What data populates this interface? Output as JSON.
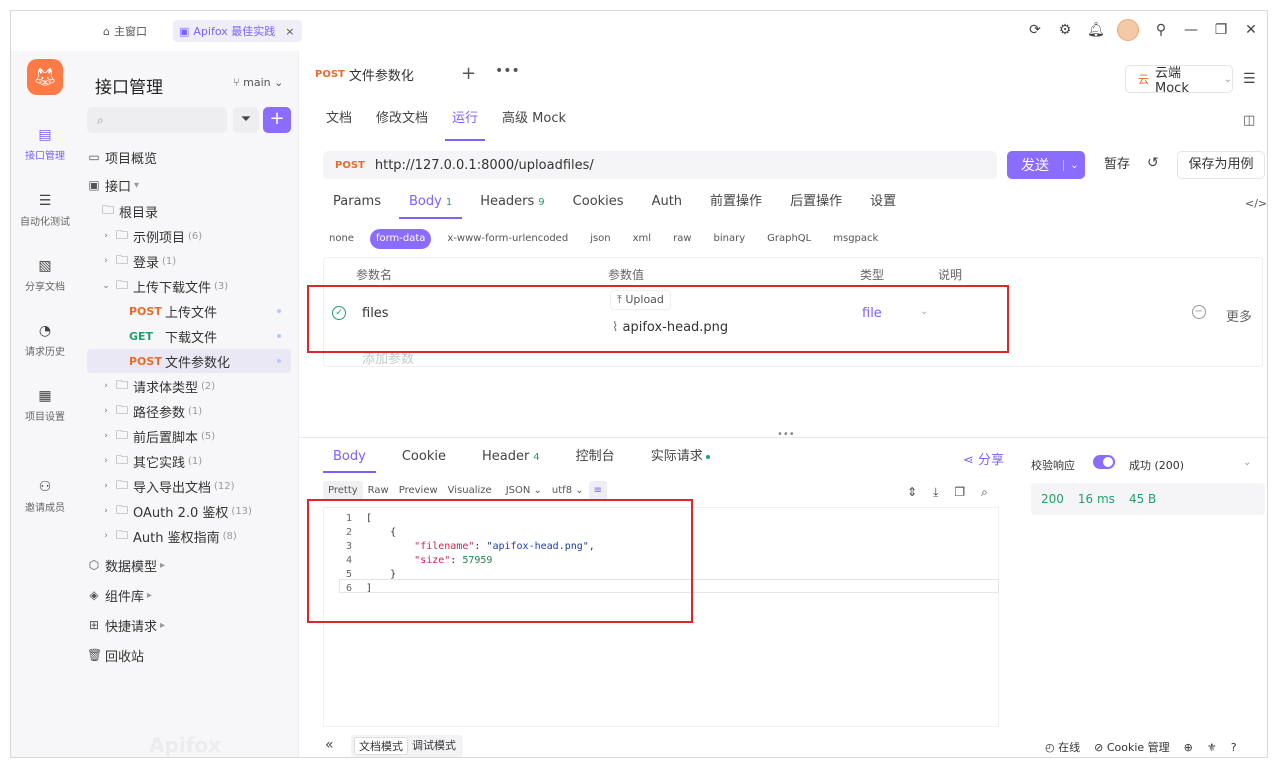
{
  "titlebar": {
    "home_label": "主窗口",
    "project_tab": "Apifox 最佳实践",
    "close_glyph": "×"
  },
  "rail": {
    "items": [
      {
        "label": "接口管理",
        "icon": "api-icon",
        "active": true
      },
      {
        "label": "自动化测试",
        "icon": "test-icon"
      },
      {
        "label": "分享文档",
        "icon": "share-doc-icon"
      },
      {
        "label": "请求历史",
        "icon": "history-icon"
      },
      {
        "label": "项目设置",
        "icon": "settings-icon"
      },
      {
        "label": "邀请成员",
        "icon": "invite-icon"
      }
    ]
  },
  "tree": {
    "title": "接口管理",
    "branch": "main",
    "overview": "项目概览",
    "interface_label": "接口",
    "root": "根目录",
    "folders": [
      {
        "name": "示例项目",
        "count": "(6)"
      },
      {
        "name": "登录",
        "count": "(1)"
      },
      {
        "name": "上传下载文件",
        "count": "(3)"
      }
    ],
    "endpoints": [
      {
        "method": "POST",
        "name": "上传文件"
      },
      {
        "method": "GET",
        "name": "下载文件"
      },
      {
        "method": "POST",
        "name": "文件参数化"
      }
    ],
    "folders2": [
      {
        "name": "请求体类型",
        "count": "(2)"
      },
      {
        "name": "路径参数",
        "count": "(1)"
      },
      {
        "name": "前后置脚本",
        "count": "(5)"
      },
      {
        "name": "其它实践",
        "count": "(1)"
      },
      {
        "name": "导入导出文档",
        "count": "(12)"
      },
      {
        "name": "OAuth 2.0 鉴权",
        "count": "(13)"
      },
      {
        "name": "Auth 鉴权指南",
        "count": "(8)"
      }
    ],
    "bottom": [
      "数据模型",
      "组件库",
      "快捷请求",
      "回收站"
    ],
    "watermark": "Apifox"
  },
  "main": {
    "request_tab": {
      "method": "POST",
      "title": "文件参数化"
    },
    "mock_label": "云端 Mock",
    "mock_tag": "云",
    "subtabs": [
      "文档",
      "修改文档",
      "运行",
      "高级 Mock"
    ],
    "active_subtab": 2,
    "url": {
      "method": "POST",
      "value": "http://127.0.0.1:8000/uploadfiles/"
    },
    "send": "发送",
    "save": "暂存",
    "save_case": "保存为用例",
    "param_tabs": [
      {
        "label": "Params",
        "count": ""
      },
      {
        "label": "Body",
        "count": "1"
      },
      {
        "label": "Headers",
        "count": "9"
      },
      {
        "label": "Cookies",
        "count": ""
      },
      {
        "label": "Auth",
        "count": ""
      },
      {
        "label": "前置操作",
        "count": ""
      },
      {
        "label": "后置操作",
        "count": ""
      },
      {
        "label": "设置",
        "count": ""
      }
    ],
    "body_types": [
      "none",
      "form-data",
      "x-www-form-urlencoded",
      "json",
      "xml",
      "raw",
      "binary",
      "GraphQL",
      "msgpack"
    ],
    "active_body_type": "form-data",
    "table": {
      "headers": {
        "name": "参数名",
        "value": "参数值",
        "type": "类型",
        "desc": "说明"
      },
      "row": {
        "name": "files",
        "upload": "Upload",
        "file": "apifox-head.png",
        "type": "file",
        "more": "更多"
      },
      "add_placeholder": "添加参数"
    }
  },
  "response": {
    "tabs": [
      {
        "label": "Body",
        "count": ""
      },
      {
        "label": "Cookie",
        "count": ""
      },
      {
        "label": "Header",
        "count": "4"
      },
      {
        "label": "控制台",
        "count": ""
      },
      {
        "label": "实际请求",
        "count": ""
      }
    ],
    "share": "分享",
    "view_modes": [
      "Pretty",
      "Raw",
      "Preview",
      "Visualize"
    ],
    "format": "JSON",
    "encoding": "utf8",
    "code_lines": [
      {
        "n": "1",
        "text": "["
      },
      {
        "n": "2",
        "text": "    {"
      },
      {
        "n": "3",
        "key": "\"filename\"",
        "val": "\"apifox-head.png\"",
        "kind": "s",
        "trail": ","
      },
      {
        "n": "4",
        "key": "\"size\"",
        "val": "57959",
        "kind": "n",
        "trail": ""
      },
      {
        "n": "5",
        "text": "    }"
      },
      {
        "n": "6",
        "text": "]"
      }
    ],
    "validate_label": "校验响应",
    "status": "成功 (200)",
    "metrics": {
      "code": "200",
      "time": "16 ms",
      "size": "45 B"
    }
  },
  "statusbar": {
    "modes": [
      "文档模式",
      "调试模式"
    ],
    "online": "在线",
    "cookie": "Cookie 管理"
  }
}
